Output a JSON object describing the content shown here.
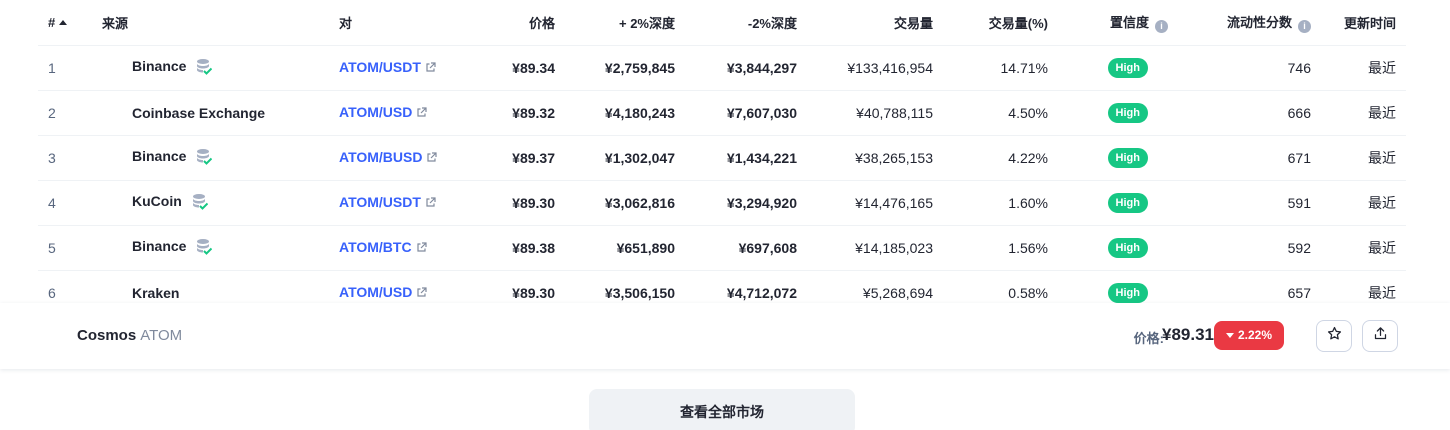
{
  "table": {
    "headers": {
      "rank": "#",
      "source": "来源",
      "pair": "对",
      "price": "价格",
      "depth_pos": "+ 2%深度",
      "depth_neg": "-2%深度",
      "volume": "交易量",
      "volume_pct": "交易量(%)",
      "confidence": "置信度",
      "liquidity": "流动性分数",
      "updated": "更新时间"
    },
    "rows": [
      {
        "rank": "1",
        "source": "Binance",
        "cex": true,
        "pair": "ATOM/USDT",
        "price": "¥89.34",
        "depth_pos": "¥2,759,845",
        "depth_neg": "¥3,844,297",
        "volume": "¥133,416,954",
        "volume_pct": "14.71%",
        "confidence": "High",
        "liquidity": "746",
        "updated": "最近"
      },
      {
        "rank": "2",
        "source": "Coinbase Exchange",
        "cex": false,
        "pair": "ATOM/USD",
        "price": "¥89.32",
        "depth_pos": "¥4,180,243",
        "depth_neg": "¥7,607,030",
        "volume": "¥40,788,115",
        "volume_pct": "4.50%",
        "confidence": "High",
        "liquidity": "666",
        "updated": "最近"
      },
      {
        "rank": "3",
        "source": "Binance",
        "cex": true,
        "pair": "ATOM/BUSD",
        "price": "¥89.37",
        "depth_pos": "¥1,302,047",
        "depth_neg": "¥1,434,221",
        "volume": "¥38,265,153",
        "volume_pct": "4.22%",
        "confidence": "High",
        "liquidity": "671",
        "updated": "最近"
      },
      {
        "rank": "4",
        "source": "KuCoin",
        "cex": true,
        "pair": "ATOM/USDT",
        "price": "¥89.30",
        "depth_pos": "¥3,062,816",
        "depth_neg": "¥3,294,920",
        "volume": "¥14,476,165",
        "volume_pct": "1.60%",
        "confidence": "High",
        "liquidity": "591",
        "updated": "最近"
      },
      {
        "rank": "5",
        "source": "Binance",
        "cex": true,
        "pair": "ATOM/BTC",
        "price": "¥89.38",
        "depth_pos": "¥651,890",
        "depth_neg": "¥697,608",
        "volume": "¥14,185,023",
        "volume_pct": "1.56%",
        "confidence": "High",
        "liquidity": "592",
        "updated": "最近"
      },
      {
        "rank": "6",
        "source": "Kraken",
        "cex": false,
        "pair": "ATOM/USD",
        "price": "¥89.30",
        "depth_pos": "¥3,506,150",
        "depth_neg": "¥4,712,072",
        "volume": "¥5,268,694",
        "volume_pct": "0.58%",
        "confidence": "High",
        "liquidity": "657",
        "updated": "最近"
      }
    ]
  },
  "sticky": {
    "coin_name": "Cosmos",
    "coin_symbol": "ATOM",
    "price_label": "价格:",
    "price": "¥89.31",
    "change": "2.22%",
    "change_color": "#ea3943"
  },
  "view_all_label": "查看全部市场",
  "colors": {
    "accent": "#3861fb",
    "confidence_high": "#16c784",
    "negative": "#ea3943"
  }
}
